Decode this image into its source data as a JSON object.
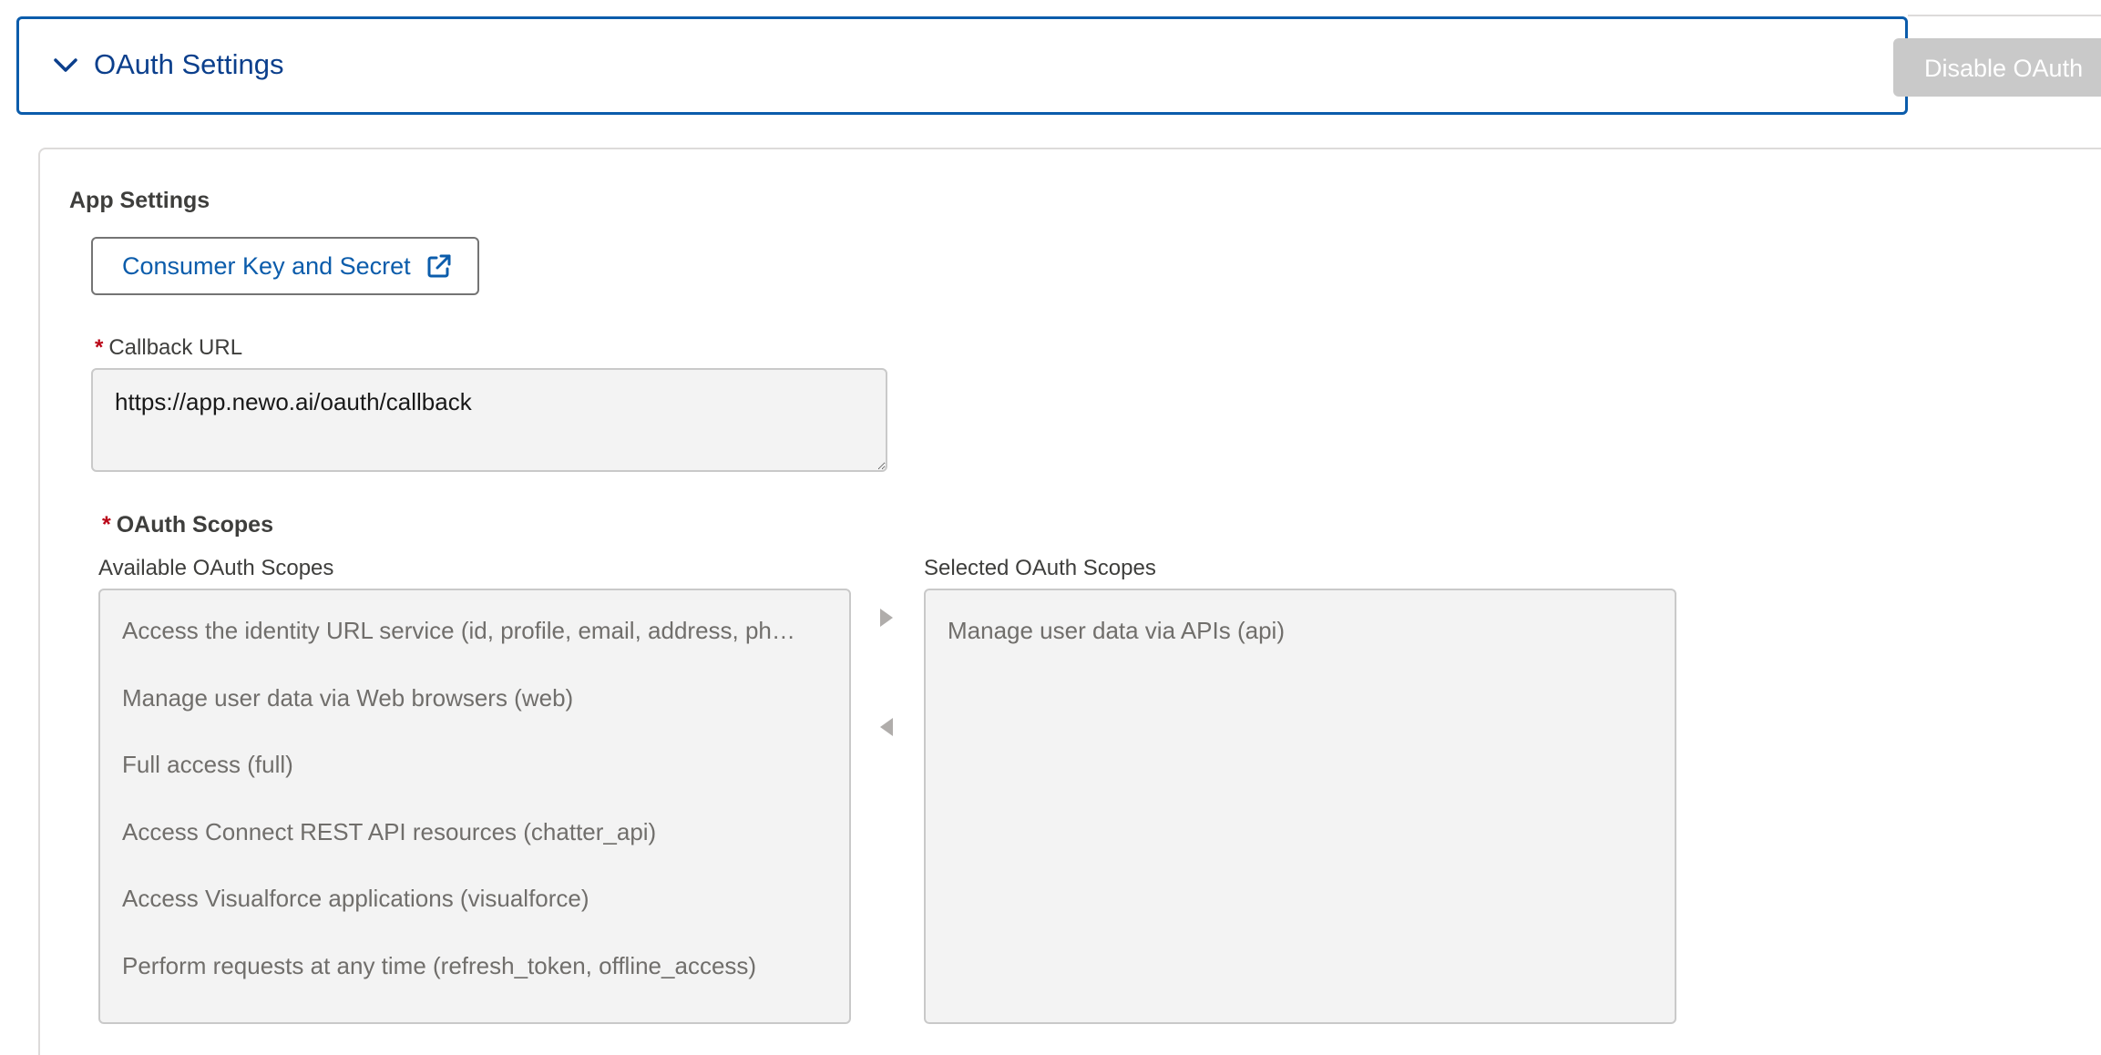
{
  "header": {
    "title": "OAuth Settings",
    "toggle_icon": "chevron-down-icon",
    "disable_button_label": "Disable OAuth"
  },
  "app_settings": {
    "title": "App Settings",
    "consumer_button_label": "Consumer Key and Secret",
    "consumer_button_icon": "external-link-icon",
    "callback": {
      "required_marker": "*",
      "label": "Callback URL",
      "value": "https://app.newo.ai/oauth/callback"
    }
  },
  "oauth_scopes": {
    "required_marker": "*",
    "title": "OAuth Scopes",
    "available_label": "Available OAuth Scopes",
    "selected_label": "Selected OAuth Scopes",
    "available": [
      "Access the identity URL service (id, profile, email, address, ph…",
      "Manage user data via Web browsers (web)",
      "Full access (full)",
      "Access Connect REST API resources (chatter_api)",
      "Access Visualforce applications (visualforce)",
      "Perform requests at any time (refresh_token, offline_access)"
    ],
    "selected": [
      "Manage user data via APIs (api)"
    ],
    "move_right_icon": "triangle-right-icon",
    "move_left_icon": "triangle-left-icon"
  },
  "colors": {
    "brand_blue": "#0b5cab",
    "title_blue": "#0b3f8c",
    "required_red": "#ba0517",
    "disabled_button": "#c9c9c9",
    "field_bg": "#f3f3f3"
  }
}
